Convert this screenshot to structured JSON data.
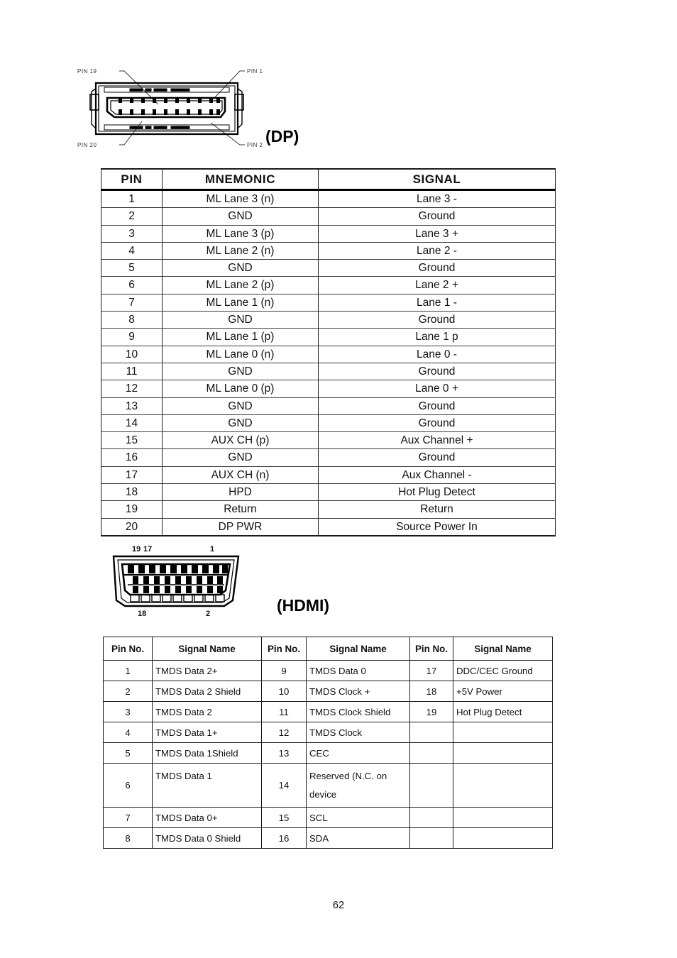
{
  "page": {
    "number": "62"
  },
  "dp_connector": {
    "caption": "(DP)",
    "icon": "displayport-connector-icon",
    "labels": {
      "top_left": "PIN 19",
      "top_right": "PIN 1",
      "bottom_left": "PIN 20",
      "bottom_right": "PIN 2"
    }
  },
  "dp_table": {
    "headers": [
      "PIN",
      "MNEMONIC",
      "SIGNAL"
    ],
    "rows": [
      [
        "1",
        "ML Lane 3 (n)",
        "Lane 3 -"
      ],
      [
        "2",
        "GND",
        "Ground"
      ],
      [
        "3",
        "ML Lane 3 (p)",
        "Lane 3 +"
      ],
      [
        "4",
        "ML Lane 2 (n)",
        "Lane 2 -"
      ],
      [
        "5",
        "GND",
        "Ground"
      ],
      [
        "6",
        "ML Lane 2 (p)",
        "Lane 2 +"
      ],
      [
        "7",
        "ML Lane 1 (n)",
        "Lane 1 -"
      ],
      [
        "8",
        "GND",
        "Ground"
      ],
      [
        "9",
        "ML Lane 1 (p)",
        "Lane 1 p"
      ],
      [
        "10",
        "ML Lane 0 (n)",
        "Lane 0 -"
      ],
      [
        "11",
        "GND",
        "Ground"
      ],
      [
        "12",
        "ML Lane 0 (p)",
        "Lane 0 +"
      ],
      [
        "13",
        "GND",
        "Ground"
      ],
      [
        "14",
        "GND",
        "Ground"
      ],
      [
        "15",
        "AUX CH (p)",
        "Aux Channel +"
      ],
      [
        "16",
        "GND",
        "Ground"
      ],
      [
        "17",
        "AUX CH (n)",
        "Aux Channel -"
      ],
      [
        "18",
        "HPD",
        "Hot Plug Detect"
      ],
      [
        "19",
        "Return",
        "Return"
      ],
      [
        "20",
        "DP PWR",
        "Source Power In"
      ]
    ]
  },
  "hdmi_connector": {
    "caption": "(HDMI)",
    "icon": "hdmi-connector-icon",
    "labels": {
      "top_left_a": "19",
      "top_left_b": "17",
      "top_right": "1",
      "bottom_left": "18",
      "bottom_right": "2"
    }
  },
  "hdmi_table": {
    "headers": [
      "Pin No.",
      "Signal Name",
      "Pin No.",
      "Signal Name",
      "Pin No.",
      "Signal Name"
    ],
    "rows": [
      [
        "1",
        "TMDS Data 2+",
        "9",
        "TMDS Data 0",
        "17",
        "DDC/CEC Ground"
      ],
      [
        "2",
        "TMDS Data 2 Shield",
        "10",
        "TMDS Clock +",
        "18",
        "+5V Power"
      ],
      [
        "3",
        "TMDS Data 2",
        "11",
        "TMDS Clock Shield",
        "19",
        "Hot Plug Detect"
      ],
      [
        "4",
        "TMDS Data 1+",
        "12",
        "TMDS Clock",
        "",
        ""
      ],
      [
        "5",
        "TMDS Data 1Shield",
        "13",
        "CEC",
        "",
        ""
      ],
      [
        "6",
        "TMDS Data 1",
        "14",
        "Reserved (N.C. on device",
        "",
        ""
      ],
      [
        "7",
        "TMDS Data 0+",
        "15",
        "SCL",
        "",
        ""
      ],
      [
        "8",
        "TMDS Data 0 Shield",
        "16",
        "SDA",
        "",
        ""
      ]
    ],
    "tall_row_index": 5
  },
  "colors": {
    "border": "#1a1a1a",
    "text": "#111111",
    "background": "#ffffff"
  }
}
